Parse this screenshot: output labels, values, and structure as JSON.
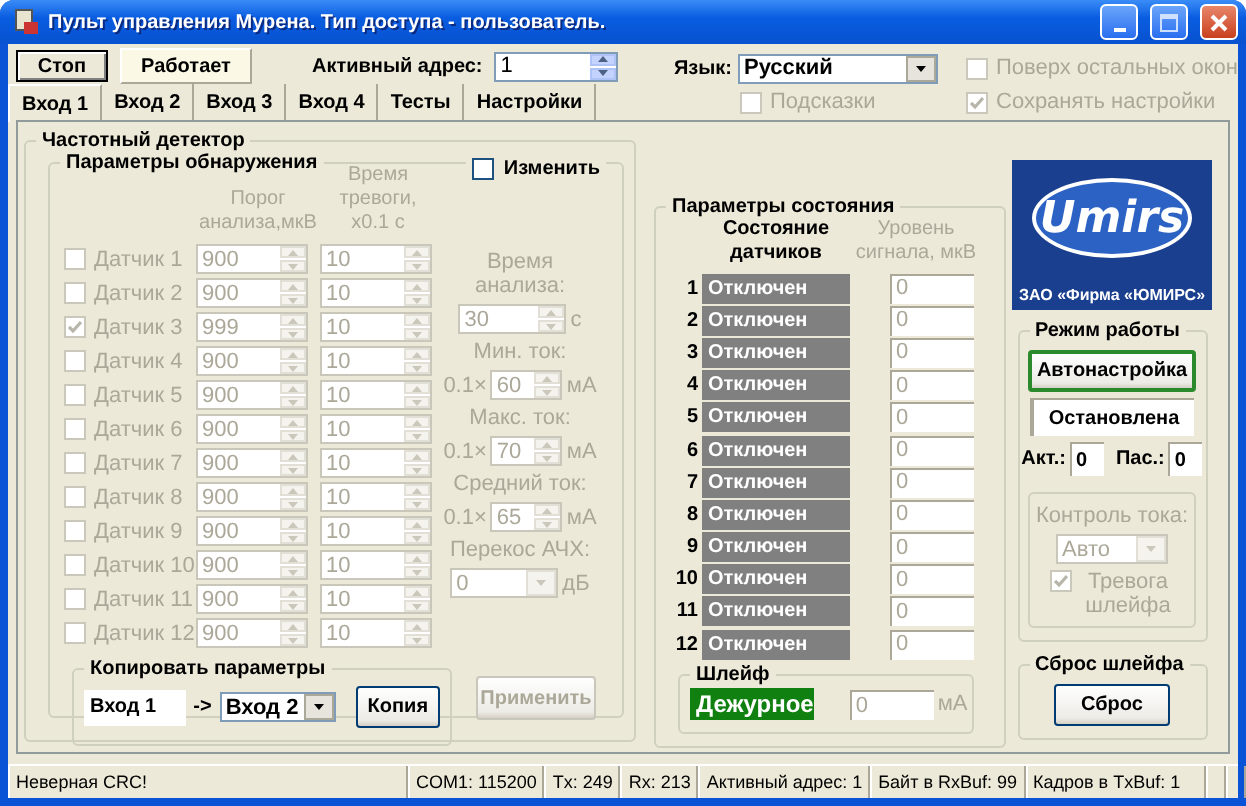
{
  "window": {
    "title": "Пульт управления Мурена. Тип доступа - пользователь."
  },
  "toolbar": {
    "stop_button": "Стоп",
    "run_status": "Работает",
    "address_label": "Активный адрес:",
    "address_value": "1",
    "language_label": "Язык:",
    "language_value": "Русский"
  },
  "options": [
    {
      "label": "Поверх остальных окон",
      "checked": false,
      "disabled": true
    },
    {
      "label": "Подсказки",
      "checked": false,
      "disabled": true
    },
    {
      "label": "Сохранять настройки",
      "checked": true,
      "disabled": true
    }
  ],
  "tabs": [
    {
      "label": "Вход 1",
      "selected": true
    },
    {
      "label": "Вход 2",
      "selected": false
    },
    {
      "label": "Вход 3",
      "selected": false
    },
    {
      "label": "Вход 4",
      "selected": false
    },
    {
      "label": "Тесты",
      "selected": false
    },
    {
      "label": "Настройки",
      "selected": false
    }
  ],
  "detector": {
    "title": "Частотный детектор",
    "detection": {
      "title": "Параметры обнаружения",
      "edit": {
        "label": "Изменить",
        "checked": false
      },
      "disabled": true,
      "threshold_header": "Порог анализа,мкВ",
      "alarm_header": "Время тревоги, x0.1 с",
      "sensors": [
        {
          "label": "Датчик 1",
          "checked": false,
          "threshold": "900",
          "alarm_time": "10"
        },
        {
          "label": "Датчик 2",
          "checked": false,
          "threshold": "900",
          "alarm_time": "10"
        },
        {
          "label": "Датчик 3",
          "checked": true,
          "threshold": "999",
          "alarm_time": "10"
        },
        {
          "label": "Датчик 4",
          "checked": false,
          "threshold": "900",
          "alarm_time": "10"
        },
        {
          "label": "Датчик 5",
          "checked": false,
          "threshold": "900",
          "alarm_time": "10"
        },
        {
          "label": "Датчик 6",
          "checked": false,
          "threshold": "900",
          "alarm_time": "10"
        },
        {
          "label": "Датчик 7",
          "checked": false,
          "threshold": "900",
          "alarm_time": "10"
        },
        {
          "label": "Датчик 8",
          "checked": false,
          "threshold": "900",
          "alarm_time": "10"
        },
        {
          "label": "Датчик 9",
          "checked": false,
          "threshold": "900",
          "alarm_time": "10"
        },
        {
          "label": "Датчик 10",
          "checked": false,
          "threshold": "900",
          "alarm_time": "10"
        },
        {
          "label": "Датчик 11",
          "checked": false,
          "threshold": "900",
          "alarm_time": "10"
        },
        {
          "label": "Датчик 12",
          "checked": false,
          "threshold": "900",
          "alarm_time": "10"
        }
      ],
      "analysis_time": {
        "label": "Время анализа:",
        "value": "30",
        "unit": "с"
      },
      "currents": [
        {
          "label": "Мин. ток:",
          "prefix": "0.1×",
          "value": "60",
          "unit": "мА"
        },
        {
          "label": "Макс. ток:",
          "prefix": "0.1×",
          "value": "70",
          "unit": "мА"
        },
        {
          "label": "Средний ток:",
          "prefix": "0.1×",
          "value": "65",
          "unit": "мА"
        }
      ],
      "skew": {
        "label": "Перекос АЧХ:",
        "value": "0",
        "unit": "дБ"
      },
      "copy": {
        "title": "Копировать параметры",
        "from": "Вход 1",
        "arrow": "->",
        "to": "Вход 2",
        "button": "Копия"
      },
      "apply_button": "Применить"
    }
  },
  "state": {
    "title": "Параметры состояния",
    "state_header": "Состояние датчиков",
    "signal_header": "Уровень сигнала, мкВ",
    "sensors": [
      {
        "number": "1",
        "state": "Отключен",
        "signal": "0"
      },
      {
        "number": "2",
        "state": "Отключен",
        "signal": "0"
      },
      {
        "number": "3",
        "state": "Отключен",
        "signal": "0"
      },
      {
        "number": "4",
        "state": "Отключен",
        "signal": "0"
      },
      {
        "number": "5",
        "state": "Отключен",
        "signal": "0"
      },
      {
        "number": "6",
        "state": "Отключен",
        "signal": "0"
      },
      {
        "number": "7",
        "state": "Отключен",
        "signal": "0"
      },
      {
        "number": "8",
        "state": "Отключен",
        "signal": "0"
      },
      {
        "number": "9",
        "state": "Отключен",
        "signal": "0"
      },
      {
        "number": "10",
        "state": "Отключен",
        "signal": "0"
      },
      {
        "number": "11",
        "state": "Отключен",
        "signal": "0"
      },
      {
        "number": "12",
        "state": "Отключен",
        "signal": "0"
      }
    ],
    "loop": {
      "title": "Шлейф",
      "state": "Дежурное",
      "current": "0",
      "unit": "мА"
    }
  },
  "logo": {
    "text": "Umirs",
    "caption": "ЗАО «Фирма «ЮМИРС»"
  },
  "mode": {
    "title": "Режим работы",
    "autotune_button": "Автонастройка",
    "status": "Остановлена",
    "active_label": "Акт.:",
    "active_value": "0",
    "passive_label": "Пас.:",
    "passive_value": "0",
    "current_control": {
      "label": "Контроль тока:",
      "value": "Авто",
      "disabled": true
    },
    "loop_alarm": {
      "label": "Тревога шлейфа",
      "checked": true,
      "disabled": true
    }
  },
  "reset": {
    "title": "Сброс шлейфа",
    "button": "Сброс"
  },
  "status_bar": [
    "Неверная CRC!",
    "COM1: 115200",
    "Tx: 249",
    "Rx: 213",
    "Активный адрес:  1",
    "Байт в RxBuf: 99",
    "Кадров в TxBuf: 1"
  ]
}
